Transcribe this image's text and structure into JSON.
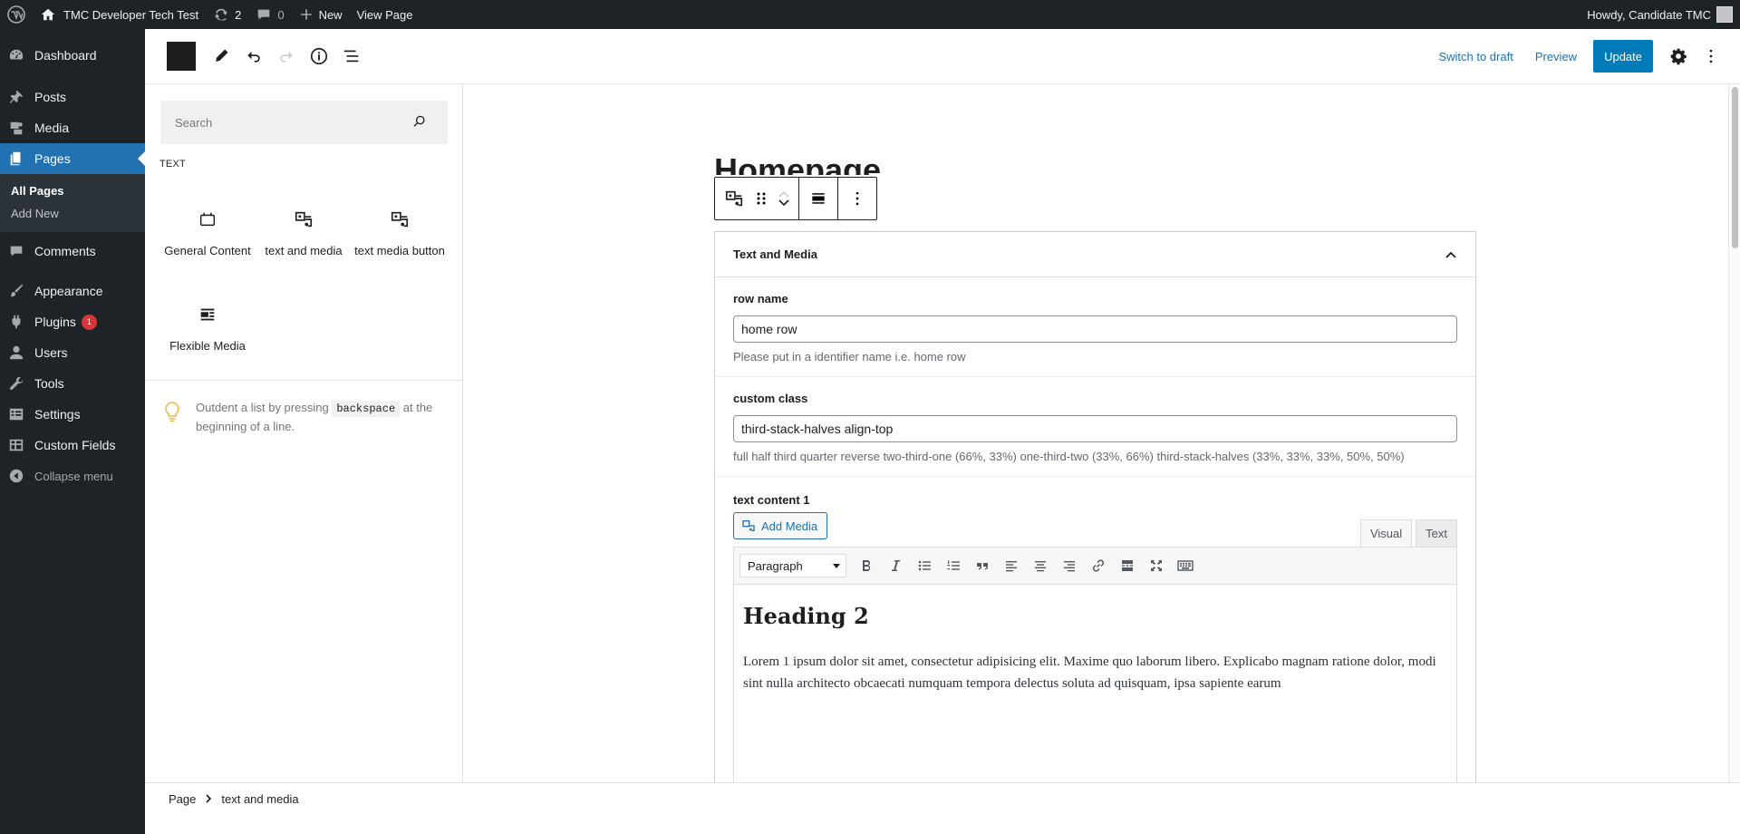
{
  "admin_bar": {
    "site_name": "TMC Developer Tech Test",
    "updates_count": "2",
    "comments_count": "0",
    "new_label": "New",
    "view_page_label": "View Page",
    "howdy": "Howdy, Candidate TMC"
  },
  "admin_menu": {
    "dashboard": "Dashboard",
    "posts": "Posts",
    "media": "Media",
    "pages": "Pages",
    "all_pages": "All Pages",
    "add_new": "Add New",
    "comments": "Comments",
    "appearance": "Appearance",
    "plugins": "Plugins",
    "plugins_badge": "1",
    "users": "Users",
    "tools": "Tools",
    "settings": "Settings",
    "custom_fields": "Custom Fields",
    "collapse": "Collapse menu"
  },
  "header": {
    "switch_to_draft": "Switch to draft",
    "preview": "Preview",
    "update": "Update"
  },
  "inserter": {
    "search_placeholder": "Search",
    "category": "TEXT",
    "blocks": [
      {
        "label": "General Content",
        "icon": "calendar-icon"
      },
      {
        "label": "text and media",
        "icon": "media-text-icon"
      },
      {
        "label": "text media button",
        "icon": "media-text-icon"
      },
      {
        "label": "Flexible Media",
        "icon": "media-layout-icon"
      }
    ],
    "tip_before": "Outdent a list by pressing",
    "tip_key": "backspace",
    "tip_after": "at the beginning of a line."
  },
  "canvas": {
    "page_title": "Homepage",
    "block_title": "Text and Media",
    "fields": {
      "row_name": {
        "label": "row name",
        "value": "home row",
        "desc": "Please put in a identifier name i.e. home row"
      },
      "custom_class": {
        "label": "custom class",
        "value": "third-stack-halves align-top",
        "desc": "full half third quarter reverse two-third-one (66%, 33%) one-third-two (33%, 66%) third-stack-halves (33%, 33%, 33%, 50%, 50%)"
      },
      "text_content": {
        "label": "text content 1",
        "add_media": "Add Media",
        "tab_visual": "Visual",
        "tab_text": "Text",
        "format": "Paragraph",
        "heading": "Heading 2",
        "paragraph": "Lorem 1 ipsum dolor sit amet, consectetur adipisicing elit. Maxime quo laborum libero. Explicabo magnam ratione dolor, modi sint nulla architecto obcaecati numquam tempora delectus soluta ad quisquam, ipsa sapiente earum"
      }
    }
  },
  "footer": {
    "crumb_1": "Page",
    "crumb_2": "text and media"
  },
  "colors": {
    "admin_bg": "#1d2327",
    "accent": "#2271b1",
    "update_btn": "#007cba",
    "badge": "#d63638"
  }
}
